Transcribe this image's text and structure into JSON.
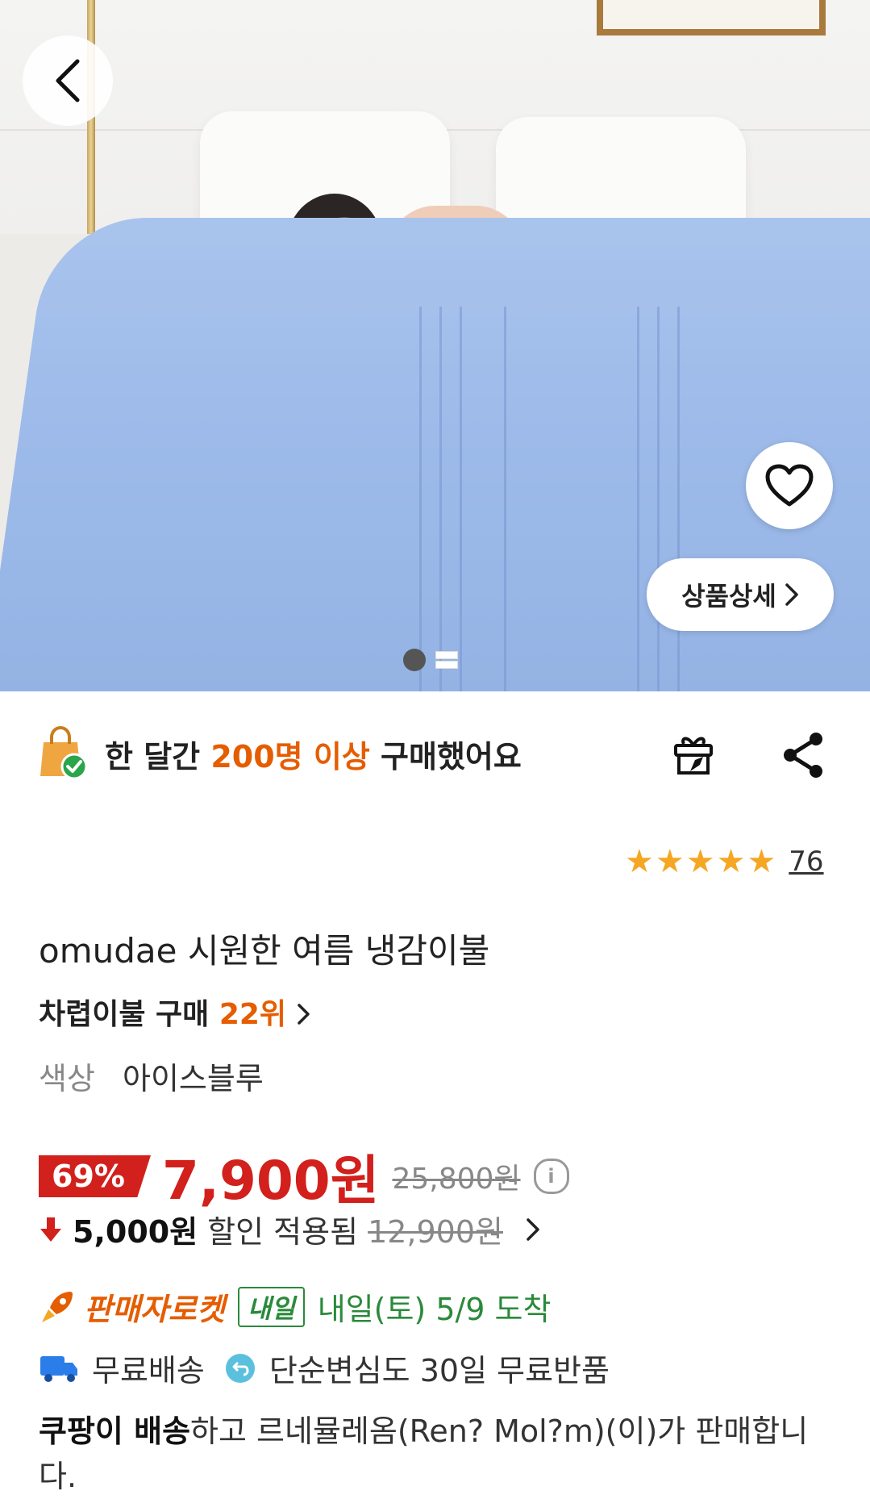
{
  "hero": {
    "detail_label": "상품상세",
    "slides_total": 2,
    "slide_index": 1
  },
  "purchase_stat": {
    "prefix": "한 달간",
    "highlight": "200명 이상",
    "suffix": "구매했어요"
  },
  "rating": {
    "stars": 5,
    "review_count": "76"
  },
  "product": {
    "title": "omudae 시원한 여름 냉감이불",
    "rank_category": "차렵이불 구매",
    "rank_value": "22위",
    "option_label": "색상",
    "option_value": "아이스블루"
  },
  "price": {
    "discount": "69%",
    "sale": "7,900원",
    "original": "25,800원",
    "coupon_amount": "5,000원",
    "coupon_text": "할인 적용됨",
    "coupon_original": "12,900원"
  },
  "shipping": {
    "rocket_label": "판매자로켓",
    "tomorrow_badge": "내일",
    "arrival": "내일(토) 5/9 도착",
    "free_shipping": "무료배송",
    "free_return": "단순변심도 30일 무료반품",
    "seller_bold": "쿠팡이 배송",
    "seller_rest": "하고 르네뮬레옴(Ren? Mol?m)(이)가 판매합니다."
  },
  "colors": {
    "accent_orange": "#e55d00",
    "sale_red": "#d2201c",
    "delivery_green": "#2a8a3a",
    "star": "#f5a623"
  }
}
